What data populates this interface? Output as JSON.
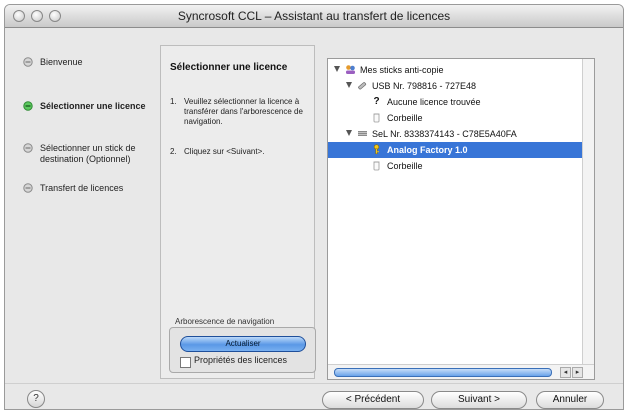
{
  "window": {
    "title": "Syncrosoft CCL – Assistant au transfert de licences"
  },
  "steps": [
    {
      "label": "Bienvenue",
      "active": false
    },
    {
      "label": "Sélectionner une licence",
      "active": true
    },
    {
      "label": "Sélectionner un stick de destination (Optionnel)",
      "active": false
    },
    {
      "label": "Transfert de licences",
      "active": false
    }
  ],
  "panel": {
    "heading": "Sélectionner une licence",
    "instructions": [
      {
        "num": "1.",
        "text": "Veuillez sélectionner la licence à transférer dans l'arborescence de navigation."
      },
      {
        "num": "2.",
        "text": "Cliquez sur <Suivant>."
      }
    ]
  },
  "navbox": {
    "label": "Arborescence de navigation",
    "refresh_button": "Actualiser",
    "checkbox_label": "Propriétés des licences",
    "checkbox_checked": false
  },
  "tree": {
    "rows": [
      {
        "label": "Mes sticks anti-copie",
        "expanded": true,
        "icon": "people-key-icon",
        "selected": false
      },
      {
        "label": "USB Nr. 798816 - 727E48",
        "expanded": true,
        "icon": "usb-stick-icon",
        "selected": false
      },
      {
        "label": "Aucune licence trouvée",
        "icon": "question-icon",
        "selected": false
      },
      {
        "label": "Corbeille",
        "icon": "trash-icon",
        "selected": false
      },
      {
        "label": "SeL Nr. 8338374143 - C78E5A40FA",
        "expanded": true,
        "icon": "hardware-key-icon",
        "selected": false
      },
      {
        "label": "Analog Factory 1.0",
        "icon": "license-key-icon",
        "selected": true
      },
      {
        "label": "Corbeille",
        "icon": "trash-icon",
        "selected": false
      }
    ]
  },
  "buttons": {
    "help": "?",
    "previous": "< Précédent",
    "next": "Suivant >",
    "cancel": "Annuler"
  },
  "colors": {
    "selection": "#3875d7",
    "step_active": "#3aa845",
    "step_inactive": "#8a8a8a"
  }
}
